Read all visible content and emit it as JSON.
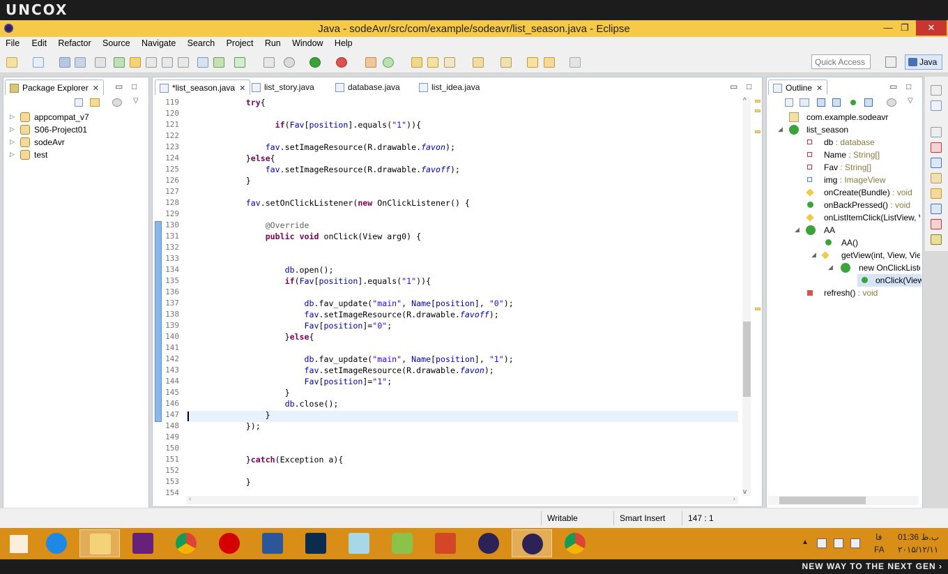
{
  "brand": {
    "top": "UNCOX",
    "bottom": "NEW WAY TO THE NEXT GEN ›"
  },
  "window": {
    "title": "Java - sodeAvr/src/com/example/sodeavr/list_season.java - Eclipse",
    "min": "—",
    "max": "❐",
    "close": "✕"
  },
  "menu": [
    "File",
    "Edit",
    "Refactor",
    "Source",
    "Navigate",
    "Search",
    "Project",
    "Run",
    "Window",
    "Help"
  ],
  "toolbar": {
    "quick_access_placeholder": "Quick Access",
    "perspective": "Java"
  },
  "package_explorer": {
    "title": "Package Explorer",
    "items": [
      "appcompat_v7",
      "S06-Project01",
      "sodeAvr",
      "test"
    ]
  },
  "editor": {
    "tabs": [
      "*list_season.java",
      "list_story.java",
      "database.java",
      "list_idea.java"
    ],
    "line_numbers": [
      "119",
      "120",
      "121",
      "122",
      "123",
      "124",
      "125",
      "126",
      "127",
      "128",
      "129",
      "130",
      "131",
      "132",
      "133",
      "134",
      "135",
      "136",
      "137",
      "138",
      "139",
      "140",
      "141",
      "142",
      "143",
      "144",
      "145",
      "146",
      "147",
      "148",
      "149",
      "150",
      "151",
      "152",
      "153",
      "154"
    ]
  },
  "outline": {
    "title": "Outline",
    "package": "com.example.sodeavr",
    "class": "list_season",
    "members": [
      {
        "name": "db",
        "type": " : database"
      },
      {
        "name": "Name",
        "type": " : String[]"
      },
      {
        "name": "Fav",
        "type": " : String[]"
      },
      {
        "name": "img",
        "type": " : ImageView"
      },
      {
        "name": "onCreate(Bundle)",
        "type": " : void"
      },
      {
        "name": "onBackPressed()",
        "type": " : void"
      },
      {
        "name": "onListItemClick(ListView, V",
        "type": ""
      }
    ],
    "inner": "AA",
    "inner_members": [
      "AA()",
      "getView(int, View, Vie",
      "new OnClickListe",
      "onClick(View"
    ],
    "refresh": {
      "name": "refresh()",
      "type": " : void"
    }
  },
  "status": {
    "writable": "Writable",
    "insert": "Smart Insert",
    "position": "147 : 1"
  },
  "tray": {
    "time": "01:36 ب.ظ",
    "date": "۲۰۱۵/۱۲/۱۱",
    "lang": "FA",
    "lang2": "فا"
  },
  "colors": {
    "titlebar": "#f7c948",
    "taskbar": "#d98e18",
    "keyword": "#7f0055",
    "string": "#2a00ff",
    "field": "#0000c0"
  },
  "taskbar_apps": [
    "start-icon",
    "ie-icon",
    "explorer-icon",
    "visual-studio-icon",
    "chrome-icon",
    "opera-icon",
    "word-icon",
    "photoshop-icon",
    "notepad-icon",
    "android-icon",
    "powerpoint-icon",
    "eclipse-icon",
    "eclipse-icon",
    "chrome-icon"
  ]
}
